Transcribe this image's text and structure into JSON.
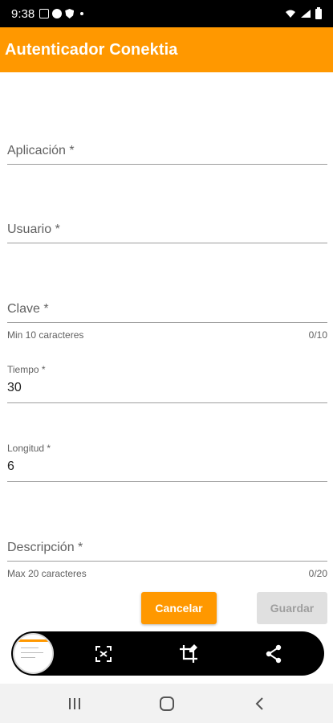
{
  "status_bar": {
    "time": "9:38"
  },
  "app_bar": {
    "title": "Autenticador Conektia"
  },
  "form": {
    "aplicacion": {
      "label": "Aplicación *"
    },
    "usuario": {
      "label": "Usuario *"
    },
    "clave": {
      "label": "Clave *",
      "helper": "Min 10 caracteres",
      "counter": "0/10"
    },
    "tiempo": {
      "label": "Tiempo *",
      "value": "30"
    },
    "longitud": {
      "label": "Longitud *",
      "value": "6"
    },
    "descripcion": {
      "label": "Descripción *",
      "helper": "Max 20 caracteres",
      "counter": "0/20"
    }
  },
  "buttons": {
    "cancel": "Cancelar",
    "save": "Guardar"
  },
  "screenshot_toolbar": {
    "icons": [
      "thumbnail",
      "scan-text-icon",
      "crop-edit-icon",
      "share-icon"
    ]
  },
  "nav_bar": {
    "icons": [
      "recents-icon",
      "home-icon",
      "back-icon"
    ]
  },
  "colors": {
    "accent": "#ff9800",
    "disabled_bg": "#e0e0e0",
    "disabled_text": "#9e9e9e"
  }
}
